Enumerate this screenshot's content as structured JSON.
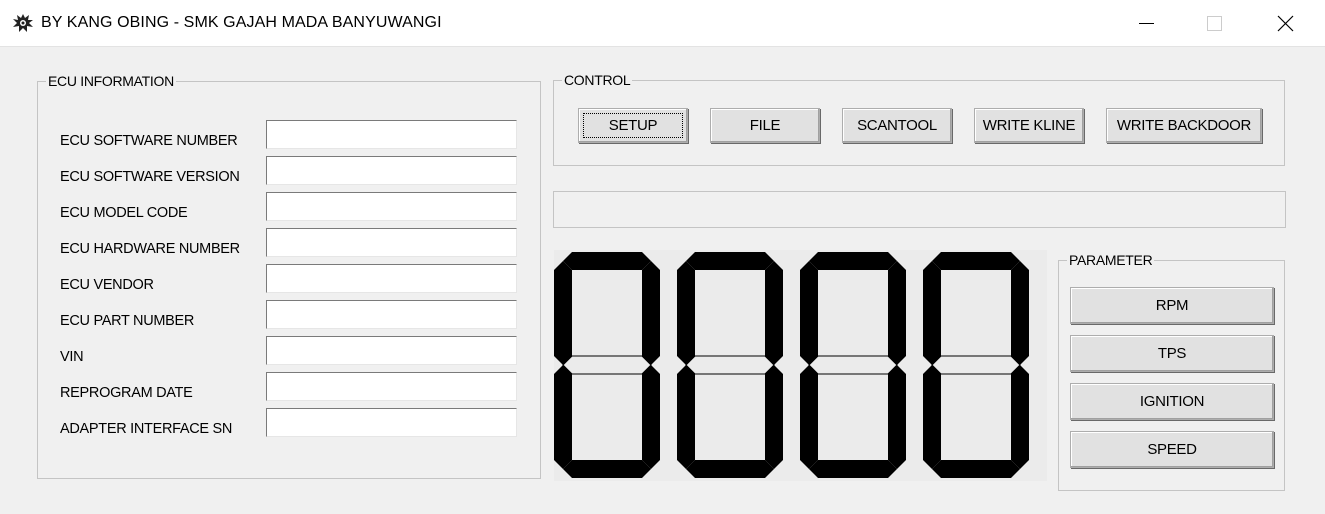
{
  "window": {
    "title": "BY KANG OBING - SMK GAJAH MADA BANYUWANGI",
    "app_icon": "gear-splash-icon",
    "controls": [
      "minimize-icon",
      "maximize-icon",
      "close-icon"
    ]
  },
  "ecu_info": {
    "label": "ECU INFORMATION",
    "fields": [
      {
        "label": "ECU SOFTWARE NUMBER",
        "value": ""
      },
      {
        "label": "ECU SOFTWARE VERSION",
        "value": ""
      },
      {
        "label": "ECU MODEL CODE",
        "value": ""
      },
      {
        "label": "ECU HARDWARE NUMBER",
        "value": ""
      },
      {
        "label": "ECU VENDOR",
        "value": ""
      },
      {
        "label": "ECU PART NUMBER",
        "value": ""
      },
      {
        "label": "VIN",
        "value": ""
      },
      {
        "label": "REPROGRAM DATE",
        "value": ""
      },
      {
        "label": "ADAPTER INTERFACE SN",
        "value": ""
      }
    ]
  },
  "control": {
    "label": "CONTROL",
    "buttons": [
      "SETUP",
      "FILE",
      "SCANTOOL",
      "WRITE KLINE",
      "WRITE BACKDOOR"
    ],
    "focused": "SETUP"
  },
  "status": {
    "text": ""
  },
  "display": {
    "digits": [
      "0",
      "0",
      "0",
      "0"
    ],
    "color": "#000000"
  },
  "parameter": {
    "label": "PARAMETER",
    "buttons": [
      "RPM",
      "TPS",
      "IGNITION",
      "SPEED"
    ]
  }
}
